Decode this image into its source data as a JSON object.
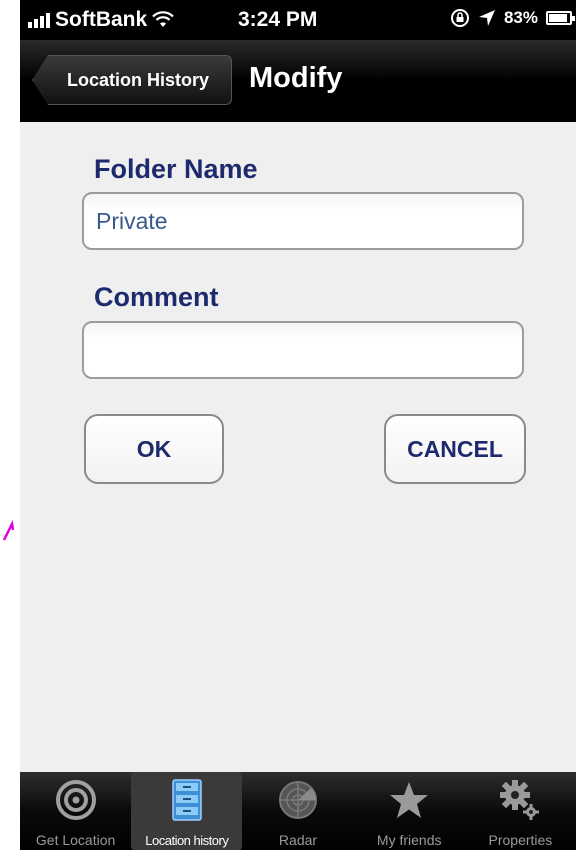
{
  "status_bar": {
    "carrier": "SoftBank",
    "time": "3:24 PM",
    "battery_percent": "83%",
    "battery_level": 0.83
  },
  "nav": {
    "back_label": "Location History",
    "title": "Modify"
  },
  "form": {
    "folder_name_label": "Folder Name",
    "folder_name_value": "Private",
    "comment_label": "Comment",
    "comment_value": "",
    "ok_label": "OK",
    "cancel_label": "CANCEL"
  },
  "tabs": [
    {
      "label": "Get Location",
      "icon": "target-icon",
      "active": false
    },
    {
      "label": "Location history",
      "icon": "file-cabinet-icon",
      "active": true
    },
    {
      "label": "Radar",
      "icon": "radar-icon",
      "active": false
    },
    {
      "label": "My friends",
      "icon": "star-icon",
      "active": false
    },
    {
      "label": "Properties",
      "icon": "gear-icon",
      "active": false
    }
  ],
  "colors": {
    "label": "#1e2a6e",
    "value_text": "#3a5a8c",
    "background": "#efefef",
    "marker": "#e000e0"
  }
}
